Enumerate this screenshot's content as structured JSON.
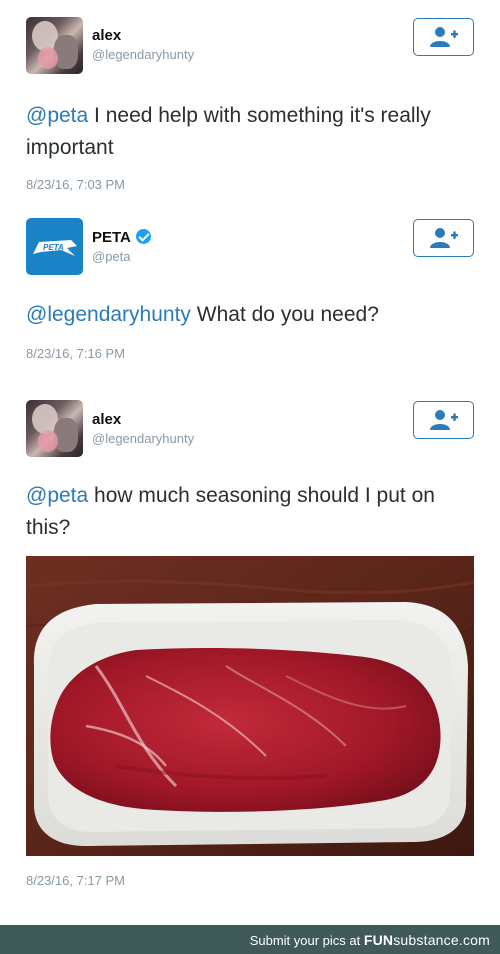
{
  "tweets": [
    {
      "name": "alex",
      "handle": "@legendaryhunty",
      "mention": "@peta",
      "text": " I need help with something it's really important",
      "timestamp": "8/23/16, 7:03 PM",
      "avatar_icon": "user-photo",
      "follow_icon": "add-user-icon"
    },
    {
      "name": "PETA",
      "handle": "@peta",
      "mention": "@legendaryhunty",
      "text": " What do you need?",
      "timestamp": "8/23/16, 7:16 PM",
      "avatar_icon": "peta-logo",
      "verified": true,
      "avatar_logo_text": "PETA",
      "follow_icon": "add-user-icon"
    },
    {
      "name": "alex",
      "handle": "@legendaryhunty",
      "mention": "@peta",
      "text": " how much seasoning should I put on this?",
      "timestamp": "8/23/16, 7:17 PM",
      "avatar_icon": "user-photo",
      "follow_icon": "add-user-icon",
      "photo_icon": "raw-steak-photo"
    }
  ],
  "footer": {
    "prefix": "Submit your pics at ",
    "brand_main": "FUN",
    "brand_sub": "substance",
    "brand_suffix": ".com"
  },
  "colors": {
    "link": "#2b7bb9",
    "muted": "#8899a6",
    "verified": "#1da1f2",
    "peta_blue": "#1a83c6",
    "footer_bg": "#3f5a58"
  }
}
